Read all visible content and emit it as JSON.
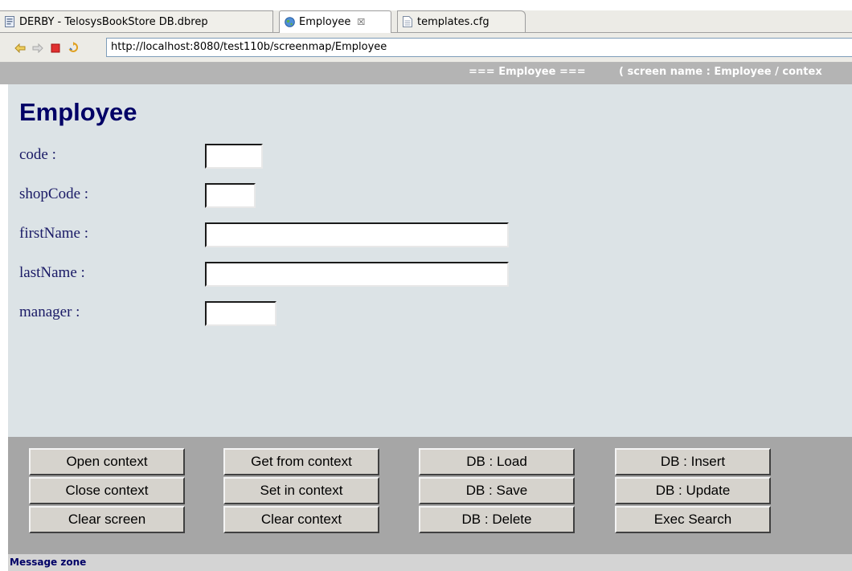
{
  "tabs": [
    {
      "label": "DERBY - TelosysBookStore DB.dbrep",
      "icon": "db-file-icon"
    },
    {
      "label": "Employee",
      "icon": "globe-icon",
      "close": "☒"
    },
    {
      "label": "templates.cfg",
      "icon": "text-file-icon"
    }
  ],
  "nav": {
    "url": "http://localhost:8080/test110b/screenmap/Employee",
    "icons": [
      "back-arrow-icon",
      "forward-arrow-icon",
      "stop-icon",
      "refresh-icon"
    ]
  },
  "header": {
    "screen_label": "=== Employee ===",
    "context_label": "( screen name : Employee / contex"
  },
  "form": {
    "title": "Employee",
    "fields": [
      {
        "label": "code :",
        "value": ""
      },
      {
        "label": "shopCode :",
        "value": ""
      },
      {
        "label": "firstName :",
        "value": ""
      },
      {
        "label": "lastName :",
        "value": ""
      },
      {
        "label": "manager :",
        "value": ""
      }
    ]
  },
  "buttons": {
    "open_context": "Open context",
    "close_context": "Close context",
    "clear_screen": "Clear screen",
    "get_from_context": "Get from context",
    "set_in_context": "Set in context",
    "clear_context": "Clear context",
    "db_load": "DB : Load",
    "db_save": "DB : Save",
    "db_delete": "DB : Delete",
    "db_insert": "DB : Insert",
    "db_update": "DB : Update",
    "exec_search": "Exec Search"
  },
  "message_zone": "Message zone",
  "colors": {
    "title": "#000066",
    "form_bg": "#dce3e6",
    "button_area_bg": "#a6a6a6",
    "header_bg": "#b4b4b4"
  }
}
